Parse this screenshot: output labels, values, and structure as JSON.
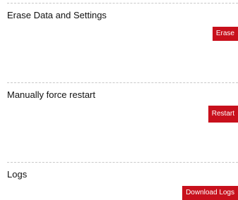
{
  "sections": [
    {
      "title": "Erase Data and Settings",
      "button_label": "Erase"
    },
    {
      "title": "Manually force restart",
      "button_label": "Restart"
    },
    {
      "title": "Logs",
      "button_label": "Download Logs"
    }
  ],
  "colors": {
    "button_background": "#c8101c",
    "button_text": "#ffffff",
    "divider": "#c8c8c8",
    "text": "#111111"
  }
}
